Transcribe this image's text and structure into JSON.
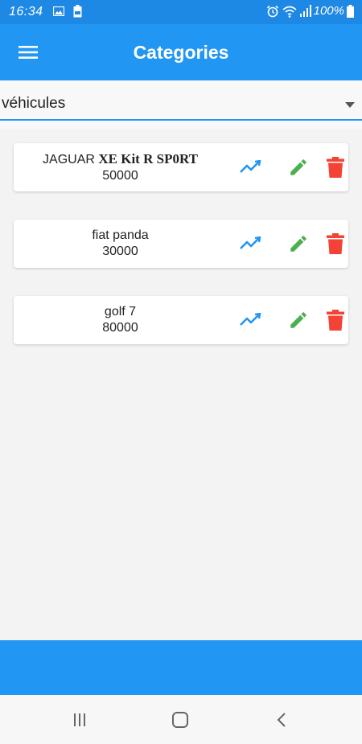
{
  "status_bar": {
    "time": "16:34",
    "battery_percent": "100%",
    "icons": [
      "image-icon",
      "battery-saver-icon",
      "alarm-icon",
      "wifi-icon",
      "signal-icon",
      "battery-icon"
    ]
  },
  "app_bar": {
    "title": "Categories",
    "menu_icon": "menu-icon"
  },
  "category_select": {
    "selected": "véhicules"
  },
  "items": [
    {
      "name": "JAGUAR XE Kit R SP0RT",
      "name_plain": "JAGUAR ",
      "name_bold": "XE Kit R SP0RT",
      "value": "50000"
    },
    {
      "name": "fiat panda",
      "value": "30000"
    },
    {
      "name": "golf 7",
      "value": "80000"
    }
  ],
  "colors": {
    "primary": "#2196f3",
    "status_bar": "#1e88e5",
    "trend": "#2196f3",
    "edit": "#4caf50",
    "delete": "#f44336"
  }
}
